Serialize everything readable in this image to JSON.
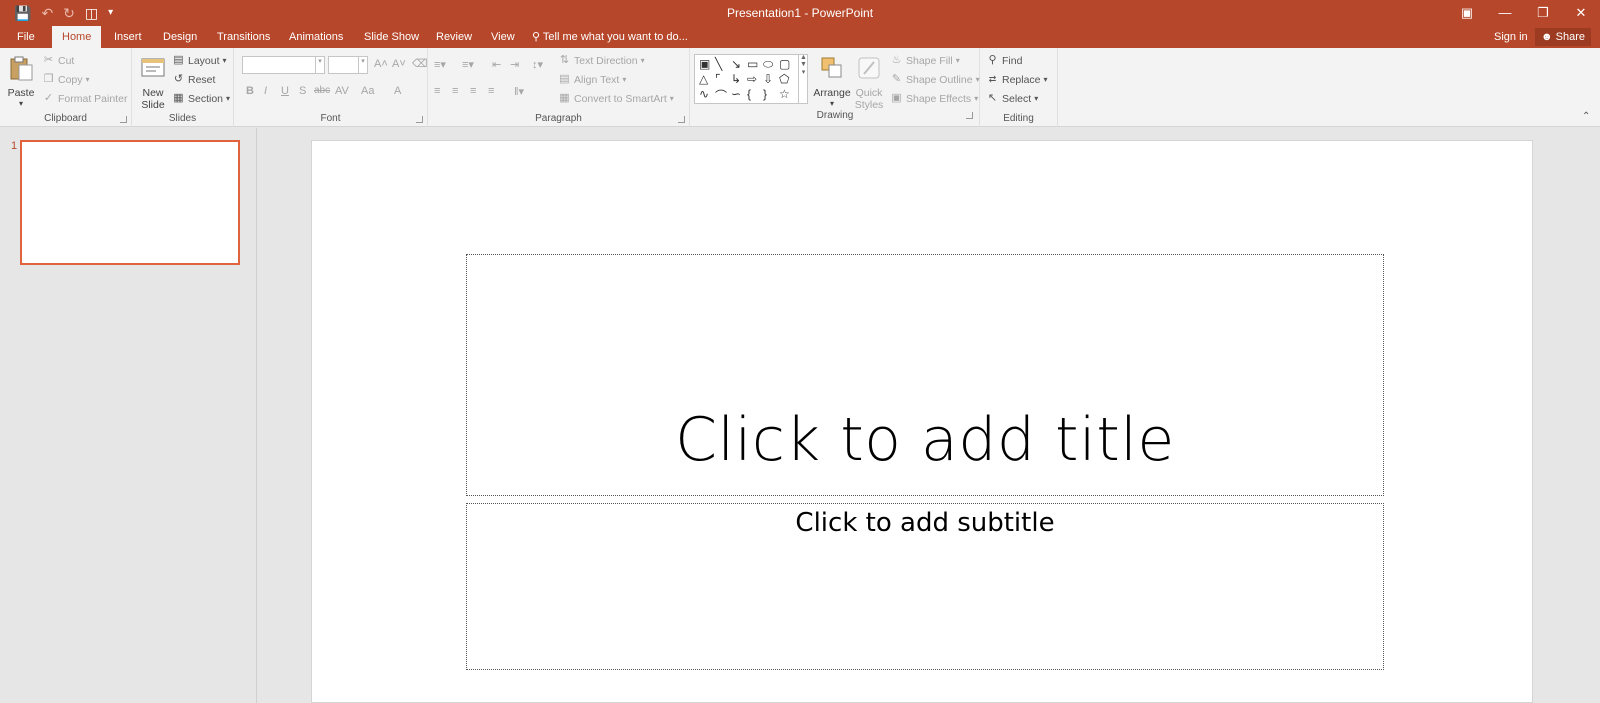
{
  "window": {
    "title": "Presentation1 - PowerPoint",
    "qat": {
      "save_icon": "save-icon",
      "undo_icon": "undo-icon",
      "redo_icon": "redo-icon",
      "present_icon": "start-from-beginning-icon",
      "customize_icon": "customize-qat-icon"
    },
    "controls": {
      "ribbon_display": "ribbon-display-options-icon",
      "minimize": "minimize-icon",
      "restore": "restore-icon",
      "close": "close-icon"
    }
  },
  "tabs": [
    "File",
    "Home",
    "Insert",
    "Design",
    "Transitions",
    "Animations",
    "Slide Show",
    "Review",
    "View"
  ],
  "active_tab": "Home",
  "tell_me": "Tell me what you want to do...",
  "account": {
    "sign_in": "Sign in",
    "share": "Share"
  },
  "ribbon": {
    "clipboard": {
      "label": "Clipboard",
      "paste": "Paste",
      "cut": "Cut",
      "copy": "Copy",
      "format_painter": "Format Painter"
    },
    "slides": {
      "label": "Slides",
      "new_slide_1": "New",
      "new_slide_2": "Slide",
      "layout": "Layout",
      "reset": "Reset",
      "section": "Section"
    },
    "font": {
      "label": "Font",
      "bold": "B",
      "italic": "I",
      "underline": "U",
      "shadow": "S",
      "strike": "abc",
      "spacing": "AV",
      "case": "Aa",
      "color": "A",
      "grow": "A˄",
      "shrink": "A˅"
    },
    "paragraph": {
      "label": "Paragraph",
      "text_direction": "Text Direction",
      "align_text": "Align Text",
      "convert_smartart": "Convert to SmartArt"
    },
    "drawing": {
      "label": "Drawing",
      "arrange": "Arrange",
      "quick_styles_1": "Quick",
      "quick_styles_2": "Styles",
      "shape_fill": "Shape Fill",
      "shape_outline": "Shape Outline",
      "shape_effects": "Shape Effects"
    },
    "editing": {
      "label": "Editing",
      "find": "Find",
      "replace": "Replace",
      "select": "Select"
    }
  },
  "thumbnails": [
    {
      "number": "1"
    }
  ],
  "slide": {
    "title_placeholder": "Click to add title",
    "subtitle_placeholder": "Click to add subtitle"
  },
  "colors": {
    "accent": "#b7472a",
    "selection": "#e0633e"
  }
}
